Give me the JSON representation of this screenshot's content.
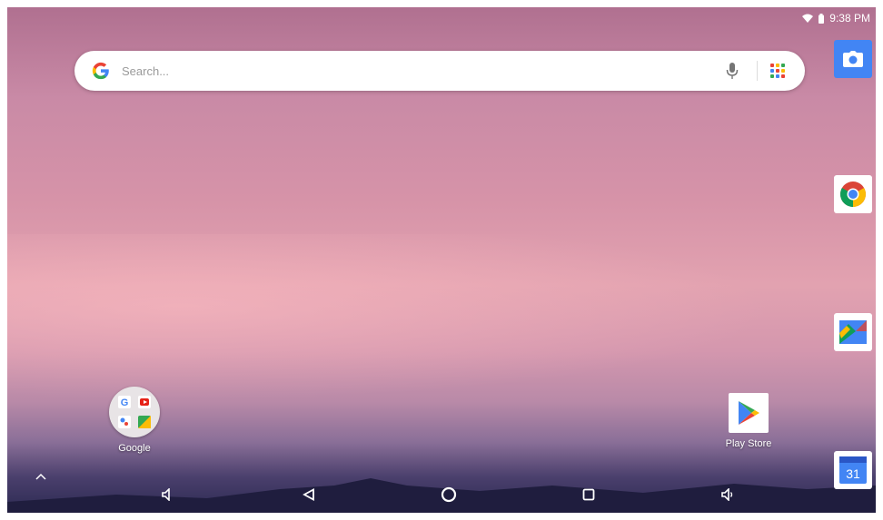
{
  "status_bar": {
    "time": "9:38 PM",
    "icons": [
      "wifi-icon",
      "battery-icon"
    ]
  },
  "search": {
    "placeholder": "Search...",
    "icons": [
      "google-g-icon",
      "mic-icon",
      "apps-grid-icon"
    ]
  },
  "dock": [
    {
      "name": "Camera",
      "icon": "camera-icon",
      "color": "#4285f4"
    },
    {
      "name": "Chrome",
      "icon": "chrome-icon"
    },
    {
      "name": "Photos",
      "icon": "photos-icon"
    },
    {
      "name": "Calendar",
      "icon": "calendar-icon",
      "text": "31"
    }
  ],
  "desktop": {
    "folder_label": "Google",
    "playstore_label": "Play Store"
  },
  "navbar": {
    "icons": [
      "volume-down-icon",
      "back-icon",
      "home-icon",
      "recents-icon",
      "volume-up-icon"
    ]
  },
  "colors": {
    "accent": "#4285f4",
    "wallpaper_top": "#b07090",
    "wallpaper_bottom": "#2c2a52"
  }
}
